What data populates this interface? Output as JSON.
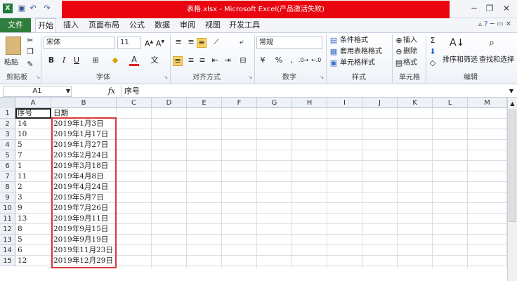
{
  "window": {
    "title": "表格.xlsx - Microsoft Excel(产品激活失败)",
    "quick_access": [
      "save-icon",
      "undo-icon",
      "redo-icon"
    ],
    "controls": [
      "─",
      "❐",
      "✕"
    ]
  },
  "tabs": {
    "file": "文件",
    "items": [
      "开始",
      "插入",
      "页面布局",
      "公式",
      "数据",
      "审阅",
      "视图",
      "开发工具"
    ]
  },
  "ribbon": {
    "clipboard": {
      "paste": "粘贴",
      "label": "剪贴板"
    },
    "font": {
      "name": "宋体",
      "size": "11",
      "bold": "B",
      "italic": "I",
      "underline": "U",
      "font_color": "A",
      "label": "字体"
    },
    "alignment": {
      "label": "对齐方式"
    },
    "number": {
      "format": "常规",
      "percent": "%",
      "comma": ",",
      "label": "数字"
    },
    "styles": {
      "conditional": "条件格式",
      "table": "套用表格格式",
      "cell": "单元格样式",
      "label": "样式"
    },
    "cells": {
      "insert": "插入",
      "delete": "删除",
      "format": "格式",
      "label": "单元格"
    },
    "editing": {
      "sort": "排序和筛选",
      "find": "查找和选择",
      "label": "编辑"
    }
  },
  "formula_bar": {
    "name_box": "A1",
    "fx": "fx",
    "content": "序号"
  },
  "sheet": {
    "columns": [
      "A",
      "B",
      "C",
      "D",
      "E",
      "F",
      "G",
      "H",
      "I",
      "J",
      "K",
      "L",
      "M"
    ],
    "rows": [
      [
        "1",
        "序号",
        "日期"
      ],
      [
        "2",
        "14",
        "2019年1月3日"
      ],
      [
        "3",
        "10",
        "2019年1月17日"
      ],
      [
        "4",
        "5",
        "2019年1月27日"
      ],
      [
        "5",
        "7",
        "2019年2月24日"
      ],
      [
        "6",
        "1",
        "2019年3月18日"
      ],
      [
        "7",
        "11",
        "2019年4月8日"
      ],
      [
        "8",
        "2",
        "2019年4月24日"
      ],
      [
        "9",
        "3",
        "2019年5月7日"
      ],
      [
        "10",
        "9",
        "2019年7月26日"
      ],
      [
        "11",
        "13",
        "2019年9月11日"
      ],
      [
        "12",
        "8",
        "2019年9月15日"
      ],
      [
        "13",
        "5",
        "2019年9月19日"
      ],
      [
        "14",
        "6",
        "2019年11月23日"
      ],
      [
        "15",
        "12",
        "2019年12月29日"
      ]
    ]
  },
  "colors": {
    "title_bar": "#e8050f",
    "file_tab": "#2f7d3a",
    "selection_border": "#d93838"
  }
}
